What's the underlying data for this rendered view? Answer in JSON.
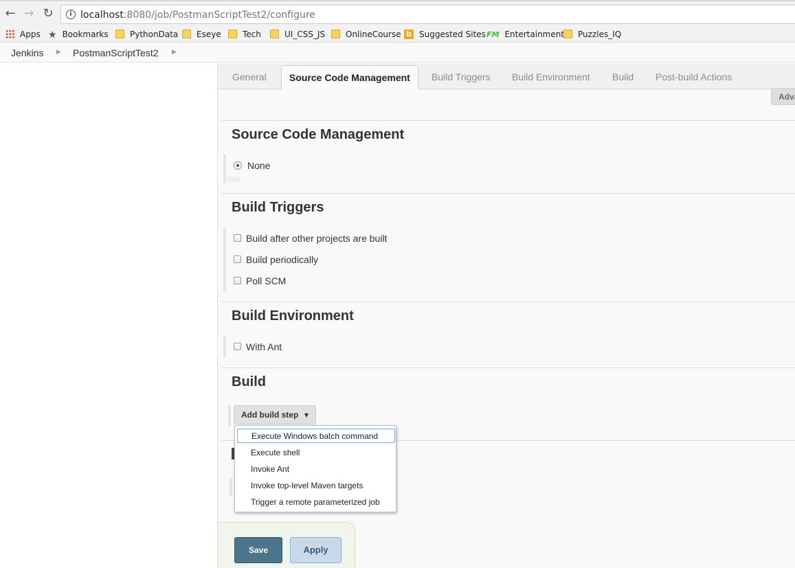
{
  "browser": {
    "url_host": "localhost",
    "url_rest": ":8080/job/PostmanScriptTest2/configure",
    "bookmarks": [
      {
        "label": "Apps",
        "icon": "apps-grid-icon"
      },
      {
        "label": "Bookmarks",
        "icon": "star-icon"
      },
      {
        "label": "PythonData",
        "icon": "folder-icon"
      },
      {
        "label": "Eseye",
        "icon": "folder-icon"
      },
      {
        "label": "Tech",
        "icon": "folder-icon"
      },
      {
        "label": "UI_CSS_JS",
        "icon": "folder-icon"
      },
      {
        "label": "OnlineCourse",
        "icon": "folder-icon"
      },
      {
        "label": "Suggested Sites",
        "icon": "bing-icon"
      },
      {
        "label": "Entertainment",
        "icon": "fm-icon"
      },
      {
        "label": "Puzzles_IQ",
        "icon": "folder-icon"
      }
    ],
    "bing_glyph": "b",
    "fm_glyph": "FM"
  },
  "breadcrumbs": [
    "Jenkins",
    "PostmanScriptTest2"
  ],
  "tabs": {
    "general": "General",
    "scm": "Source Code Management",
    "triggers": "Build Triggers",
    "environment": "Build Environment",
    "build": "Build",
    "post_build": "Post-build Actions"
  },
  "advanced_button": "Advanced...",
  "sections": {
    "scm": {
      "title": "Source Code Management",
      "options": [
        {
          "label": "None",
          "selected": true
        }
      ]
    },
    "triggers": {
      "title": "Build Triggers",
      "options": [
        {
          "label": "Build after other projects are built",
          "checked": false
        },
        {
          "label": "Build periodically",
          "checked": false
        },
        {
          "label": "Poll SCM",
          "checked": false
        }
      ]
    },
    "environment": {
      "title": "Build Environment",
      "options": [
        {
          "label": "With Ant",
          "checked": false
        }
      ]
    },
    "build": {
      "title": "Build",
      "add_step_label": "Add build step",
      "dropdown": [
        "Execute Windows batch command",
        "Execute shell",
        "Invoke Ant",
        "Invoke top-level Maven targets",
        "Trigger a remote parameterized job"
      ]
    }
  },
  "actions": {
    "save": "Save",
    "apply": "Apply"
  },
  "colors": {
    "save": "#4b758b",
    "apply": "#c9d9ea",
    "folder": "#f6d35c"
  }
}
